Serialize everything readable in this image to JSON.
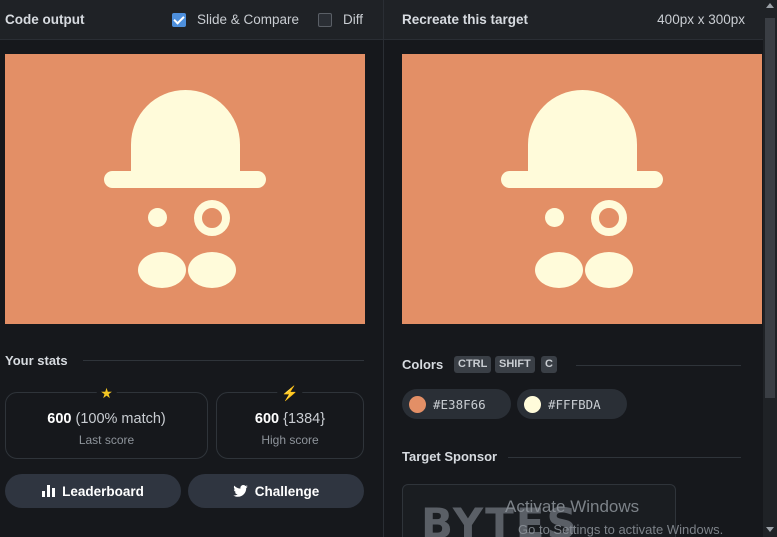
{
  "left": {
    "title": "Code output",
    "slide_compare": {
      "label": "Slide & Compare",
      "checked": true
    },
    "diff": {
      "label": "Diff",
      "checked": false
    },
    "stats": {
      "title": "Your stats",
      "last": {
        "score": "600",
        "detail": "(100% match)",
        "label": "Last score",
        "icon": "star-icon"
      },
      "high": {
        "score": "600",
        "detail": "{1384}",
        "label": "High score",
        "icon": "lightning-icon"
      }
    },
    "buttons": {
      "leaderboard": "Leaderboard",
      "challenge": "Challenge"
    }
  },
  "right": {
    "title": "Recreate this target",
    "dimensions": "400px x 300px",
    "colors": {
      "title": "Colors",
      "shortcuts": [
        "CTRL",
        "SHIFT",
        "C"
      ],
      "swatches": [
        {
          "hex": "#E38F66"
        },
        {
          "hex": "#FFFBDA"
        }
      ]
    },
    "sponsor": {
      "title": "Target Sponsor",
      "logo": "BYTES"
    }
  },
  "watermark": {
    "line1": "Activate Windows",
    "line2": "Go to Settings to activate Windows."
  },
  "colors": {
    "background": "#E38F66",
    "foreground": "#FFFBDA",
    "accent": "#4d8fdc",
    "star": "#f3c623"
  }
}
